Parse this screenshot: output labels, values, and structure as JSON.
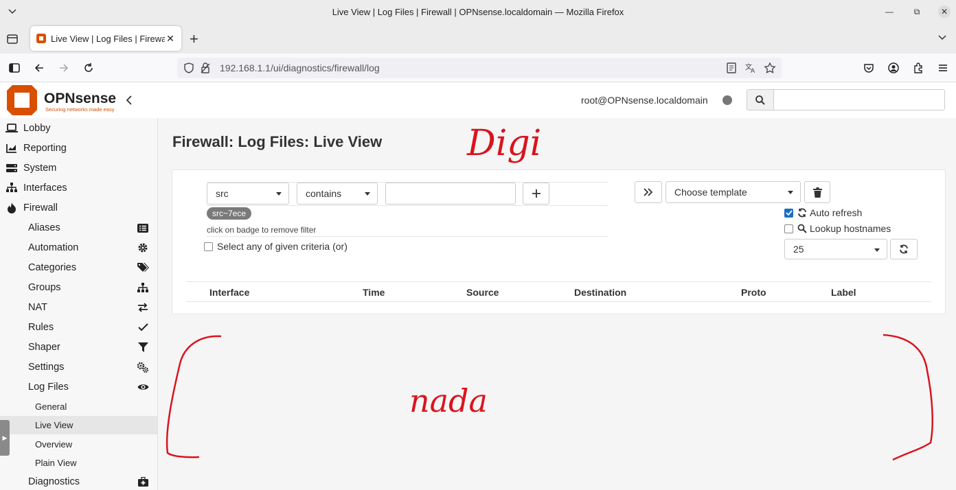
{
  "browser": {
    "window_title": "Live View | Log Files | Firewall | OPNsense.localdomain — Mozilla Firefox",
    "tab_title": "Live View | Log Files | Firewa",
    "url": "192.168.1.1/ui/diagnostics/firewall/log"
  },
  "header": {
    "brand": "OPNsense",
    "tagline": "Securing networks made easy",
    "user": "root@OPNsense.localdomain",
    "search_placeholder": ""
  },
  "sidebar": {
    "top_items": [
      {
        "label": "Lobby",
        "icon": "laptop-icon"
      },
      {
        "label": "Reporting",
        "icon": "chart-icon"
      },
      {
        "label": "System",
        "icon": "server-icon"
      },
      {
        "label": "Interfaces",
        "icon": "sitemap-icon"
      },
      {
        "label": "Firewall",
        "icon": "fire-icon"
      }
    ],
    "firewall_items": [
      {
        "label": "Aliases",
        "icon": "list-icon"
      },
      {
        "label": "Automation",
        "icon": "gear-icon"
      },
      {
        "label": "Categories",
        "icon": "tags-icon"
      },
      {
        "label": "Groups",
        "icon": "sitemap-icon"
      },
      {
        "label": "NAT",
        "icon": "exchange-icon"
      },
      {
        "label": "Rules",
        "icon": "check-icon"
      },
      {
        "label": "Shaper",
        "icon": "filter-icon"
      },
      {
        "label": "Settings",
        "icon": "gears-icon"
      },
      {
        "label": "Log Files",
        "icon": "eye-icon"
      }
    ],
    "logfile_items": [
      {
        "label": "General"
      },
      {
        "label": "Live View"
      },
      {
        "label": "Overview"
      },
      {
        "label": "Plain View"
      }
    ],
    "bottom_item": {
      "label": "Diagnostics",
      "icon": "medkit-icon"
    }
  },
  "main": {
    "title": "Firewall: Log Files: Live View",
    "filter": {
      "field": "src",
      "operator": "contains",
      "value": "",
      "badge": "src~7ece",
      "hint": "click on badge to remove filter",
      "or_label": "Select any of given criteria (or)",
      "or_checked": false
    },
    "template": {
      "placeholder": "Choose template"
    },
    "options": {
      "auto_refresh_label": "Auto refresh",
      "auto_refresh_checked": true,
      "lookup_label": "Lookup hostnames",
      "lookup_checked": false,
      "limit": "25"
    },
    "columns": [
      "Interface",
      "Time",
      "Source",
      "Destination",
      "Proto",
      "Label"
    ]
  },
  "annotations": {
    "top": "Digi",
    "bottom": "nada"
  },
  "colors": {
    "brand": "#d94f00",
    "accent": "#1b6ec2",
    "annotation": "#d9141e"
  }
}
